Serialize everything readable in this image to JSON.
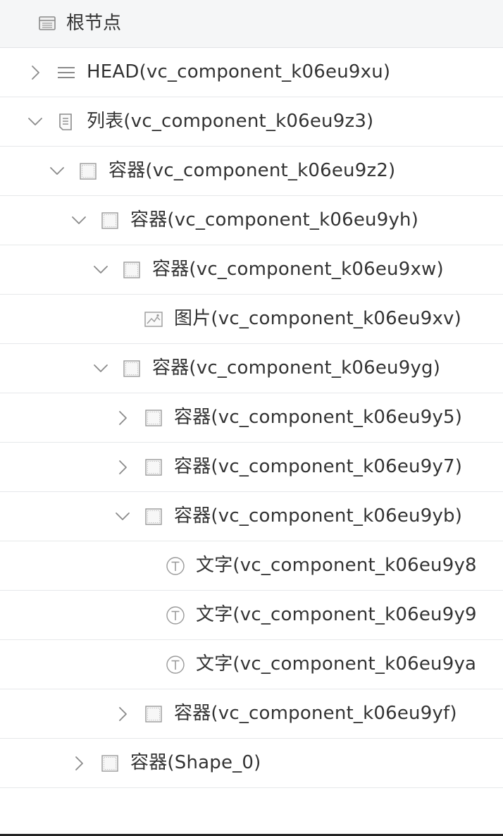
{
  "header": {
    "title": "根节点",
    "icon": "panel-icon"
  },
  "tree": [
    {
      "label": "HEAD(vc_component_k06eu9xu)",
      "icon": "list-lines-icon",
      "expander": "collapsed",
      "depth": 0
    },
    {
      "label": "列表(vc_component_k06eu9z3)",
      "icon": "document-icon",
      "expander": "expanded",
      "depth": 0
    },
    {
      "label": "容器(vc_component_k06eu9z2)",
      "icon": "container-icon",
      "expander": "expanded",
      "depth": 1
    },
    {
      "label": "容器(vc_component_k06eu9yh)",
      "icon": "container-icon",
      "expander": "expanded",
      "depth": 2
    },
    {
      "label": "容器(vc_component_k06eu9xw)",
      "icon": "container-icon",
      "expander": "expanded",
      "depth": 3
    },
    {
      "label": "图片(vc_component_k06eu9xv)",
      "icon": "image-icon",
      "expander": "none",
      "depth": 4
    },
    {
      "label": "容器(vc_component_k06eu9yg)",
      "icon": "container-icon",
      "expander": "expanded",
      "depth": 3
    },
    {
      "label": "容器(vc_component_k06eu9y5)",
      "icon": "container-icon",
      "expander": "collapsed",
      "depth": 4
    },
    {
      "label": "容器(vc_component_k06eu9y7)",
      "icon": "container-icon",
      "expander": "collapsed",
      "depth": 4
    },
    {
      "label": "容器(vc_component_k06eu9yb)",
      "icon": "container-icon",
      "expander": "expanded",
      "depth": 4
    },
    {
      "label": "文字(vc_component_k06eu9y8",
      "icon": "text-icon",
      "expander": "none",
      "depth": 5
    },
    {
      "label": "文字(vc_component_k06eu9y9",
      "icon": "text-icon",
      "expander": "none",
      "depth": 5
    },
    {
      "label": "文字(vc_component_k06eu9ya",
      "icon": "text-icon",
      "expander": "none",
      "depth": 5
    },
    {
      "label": "容器(vc_component_k06eu9yf)",
      "icon": "container-icon",
      "expander": "collapsed",
      "depth": 4
    },
    {
      "label": "容器(Shape_0)",
      "icon": "container-icon",
      "expander": "collapsed",
      "depth": 2
    }
  ]
}
